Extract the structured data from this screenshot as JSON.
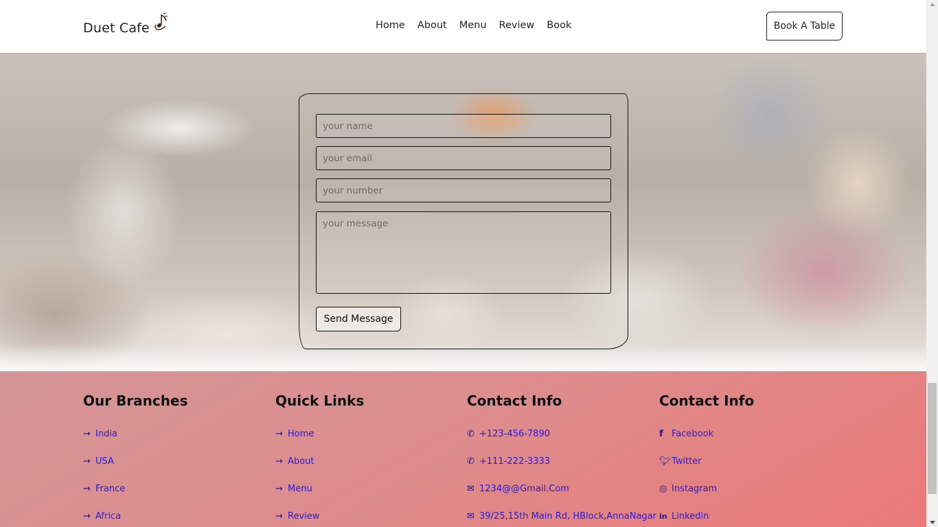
{
  "header": {
    "logo": "Duet Cafe",
    "logo_icon": "music-note-icon",
    "nav": [
      "Home",
      "About",
      "Menu",
      "Review",
      "Book"
    ],
    "cta": "Book A Table"
  },
  "booking": {
    "name_placeholder": "your name",
    "email_placeholder": "your email",
    "number_placeholder": "your number",
    "message_placeholder": "your message",
    "submit": "Send Message"
  },
  "footer": {
    "branches": {
      "title": "Our Branches",
      "items": [
        "India",
        "USA",
        "France",
        "Africa"
      ]
    },
    "quick_links": {
      "title": "Quick Links",
      "items": [
        "Home",
        "About",
        "Menu",
        "Review"
      ]
    },
    "contact": {
      "title": "Contact Info",
      "items": [
        {
          "icon": "phone-icon",
          "text": "+123-456-7890"
        },
        {
          "icon": "phone-icon",
          "text": "+111-222-3333"
        },
        {
          "icon": "envelope-icon",
          "text": "1234@@Gmail.Com"
        },
        {
          "icon": "envelope-icon",
          "text": "39/25,15th Main Rd, HBlock,AnnaNagar"
        }
      ]
    },
    "social": {
      "title": "Contact Info",
      "items": [
        {
          "icon": "facebook-icon",
          "text": "Facebook"
        },
        {
          "icon": "twitter-icon",
          "text": "Twitter"
        },
        {
          "icon": "instagram-icon",
          "text": "Instagram"
        },
        {
          "icon": "linkedin-icon",
          "text": "Linkedin"
        }
      ]
    }
  },
  "colors": {
    "footer_start": "#d49596",
    "footer_end": "#ea7978",
    "link": "#2a1bd6"
  }
}
